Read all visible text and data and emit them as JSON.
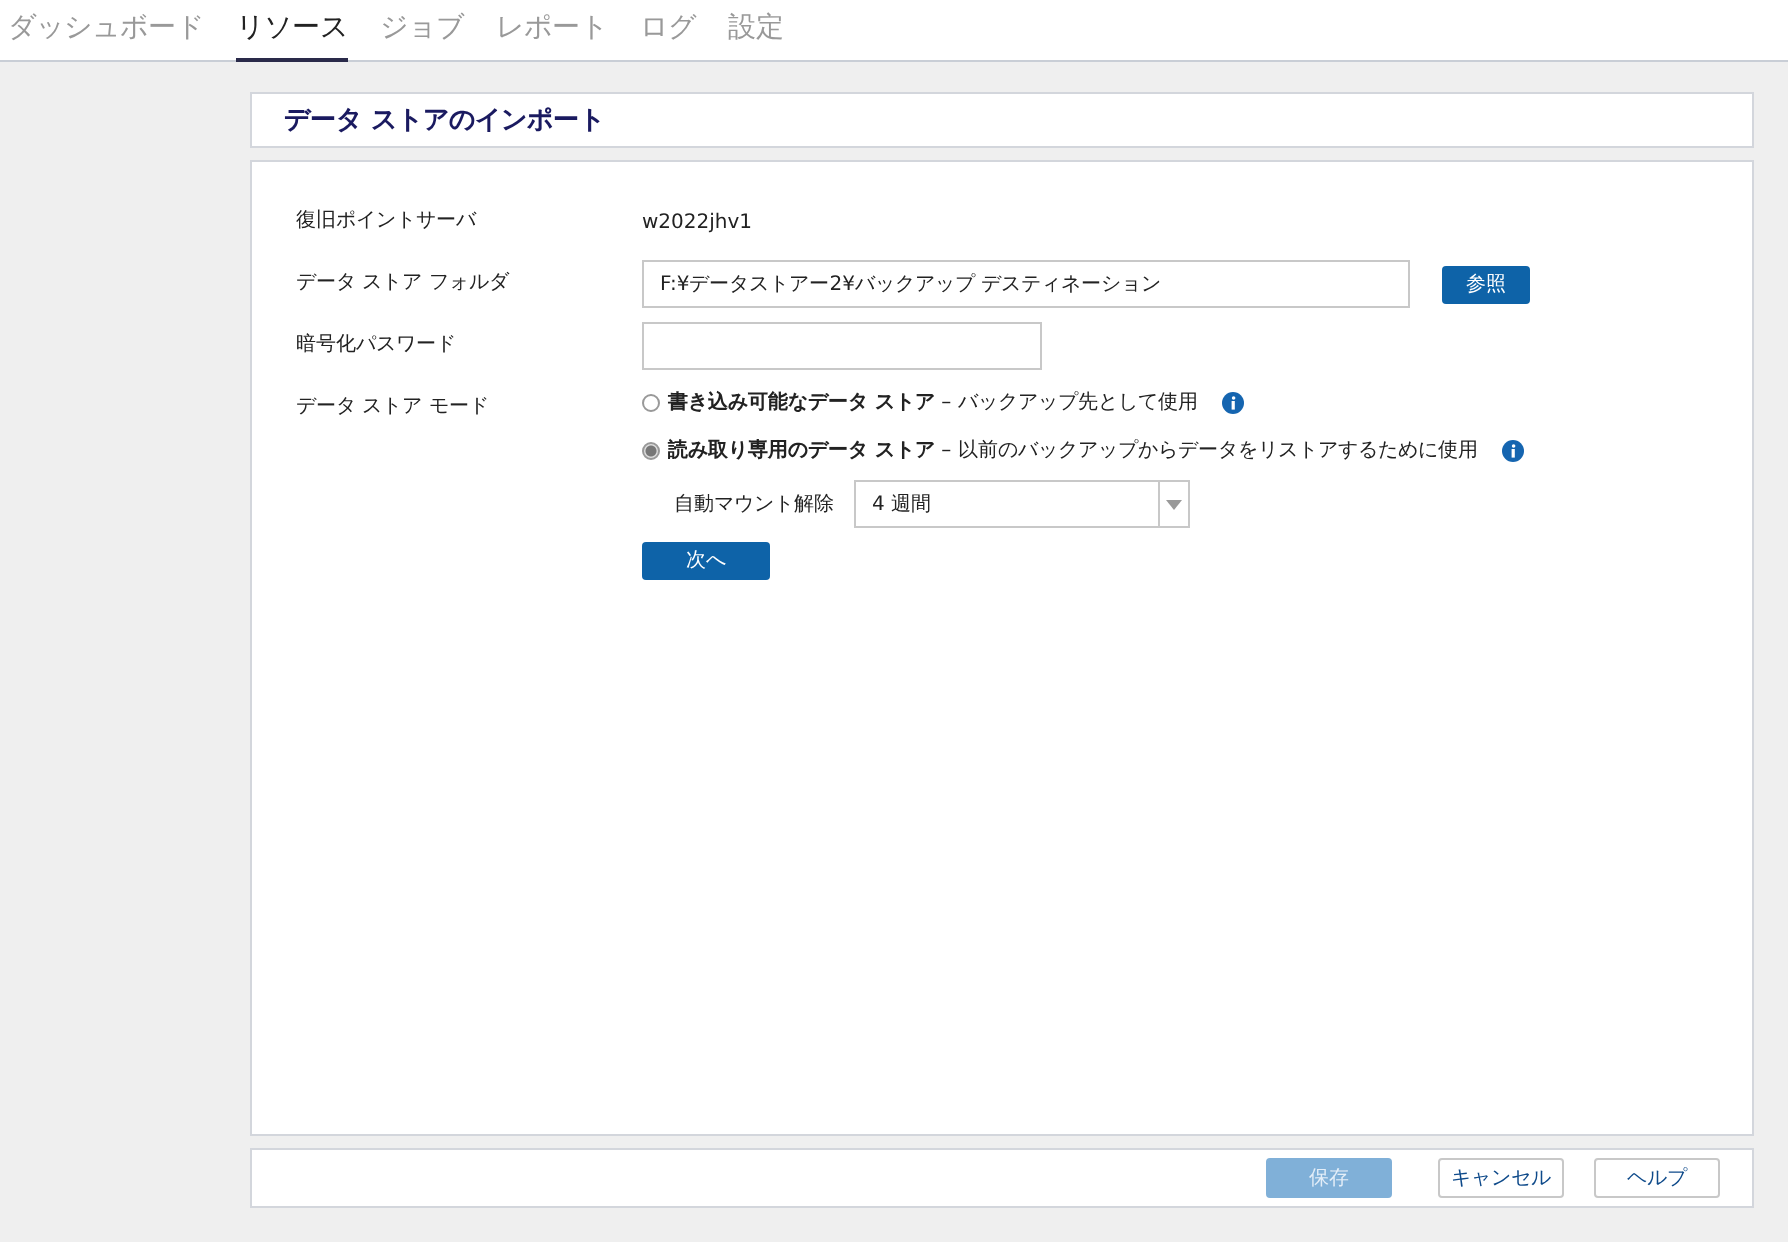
{
  "tabs": [
    {
      "label": "ダッシュボード",
      "selected": false
    },
    {
      "label": "リソース",
      "selected": true
    },
    {
      "label": "ジョブ",
      "selected": false
    },
    {
      "label": "レポート",
      "selected": false
    },
    {
      "label": "ログ",
      "selected": false
    },
    {
      "label": "設定",
      "selected": false
    }
  ],
  "page_title": "データ ストアのインポート",
  "form": {
    "server": {
      "label": "復旧ポイントサーバ",
      "value": "w2022jhv1"
    },
    "folder": {
      "label": "データ ストア フォルダ",
      "value": "F:¥データストアー2¥バックアップ デスティネーション",
      "browse": "参照"
    },
    "password": {
      "label": "暗号化パスワード"
    },
    "mode": {
      "label": "データ ストア モード",
      "options": [
        {
          "title": "書き込み可能なデータ ストア",
          "description": "– バックアップ先として使用",
          "selected": false
        },
        {
          "title": "読み取り専用のデータ ストア",
          "description": "– 以前のバックアップからデータをリストアするために使用",
          "selected": true
        }
      ]
    },
    "unmount": {
      "label": "自動マウント解除",
      "value": "4 週間"
    },
    "next": "次へ"
  },
  "footer_buttons": [
    {
      "label": "保存",
      "disabled": true
    },
    {
      "label": "キャンセル",
      "disabled": false
    },
    {
      "label": "ヘルプ",
      "disabled": false
    }
  ]
}
